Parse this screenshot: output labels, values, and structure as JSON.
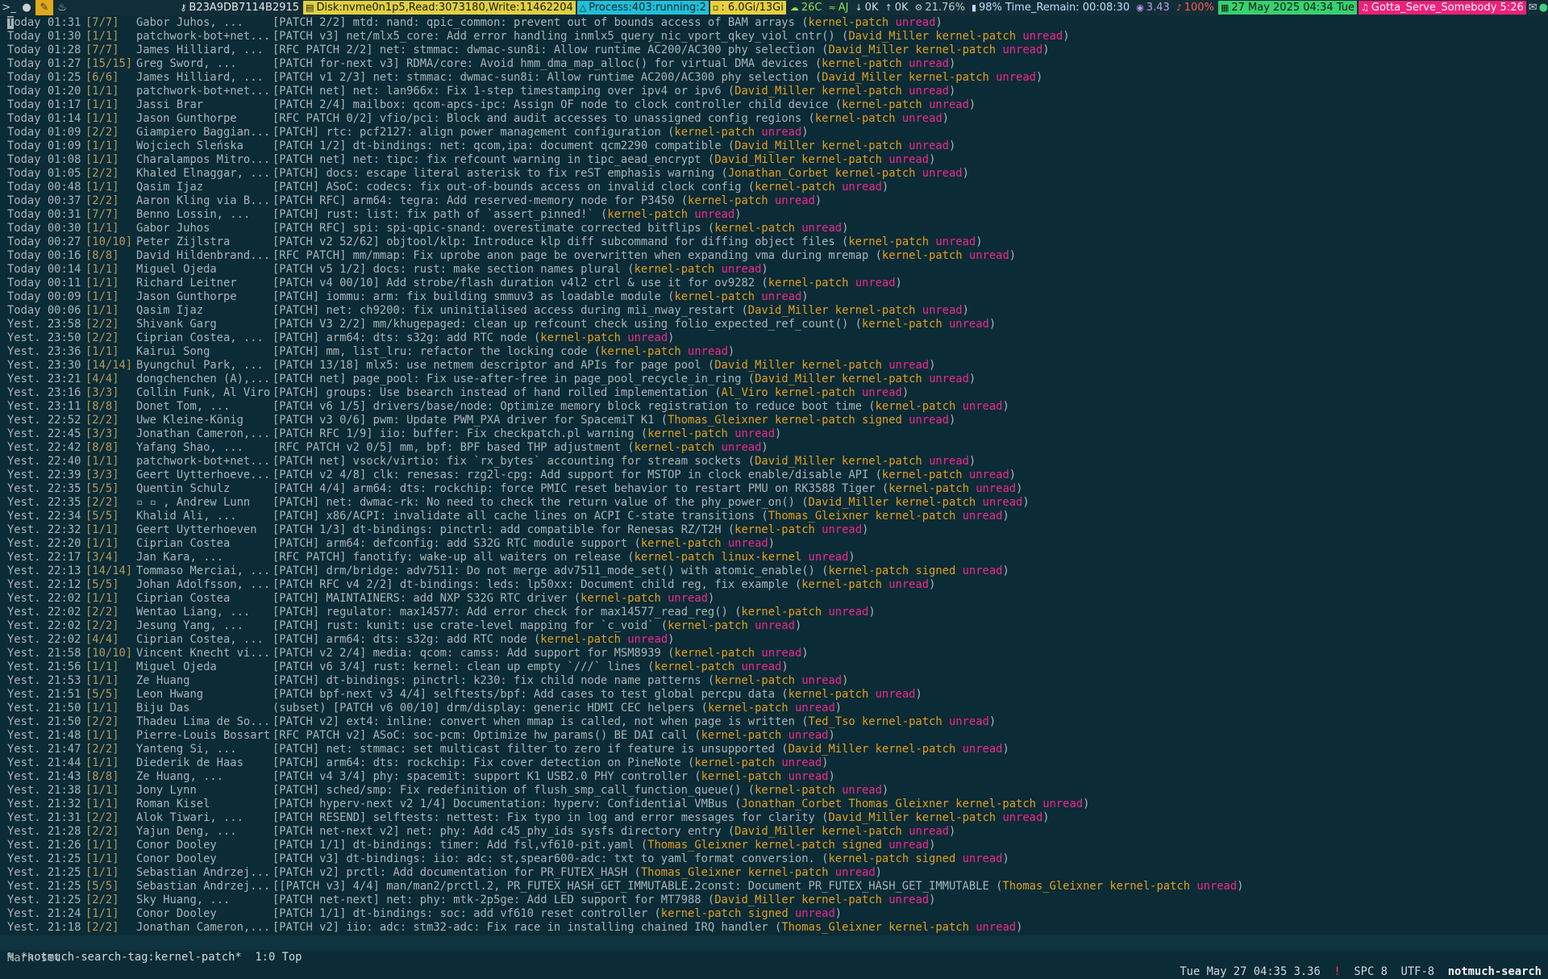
{
  "topbar": {
    "host": "B23A9DB7114B2915",
    "disk": "Disk:nvme0n1p5,Read:3073180,Write:11462204",
    "process": "Process:403:running:2",
    "memory": ": 6.0Gi/13Gi",
    "temp": "26C",
    "wifi": "AJ",
    "net_down": "0K",
    "net_up": "0K",
    "cpu": "21.76%",
    "battery": "98% Time_Remain: 00:08:30",
    "load": "3.43",
    "volume": "100%",
    "date": "27 May 2025 04:34 Tue",
    "music": "Gotta_Serve_Somebody 5:26"
  },
  "messages": [
    {
      "date": "Today 01:31",
      "count": "[7/7]",
      "author": "Gabor Juhos, ...",
      "subject": "[PATCH 2/2] mtd: nand: qpic_common: prevent out of bounds access of BAM arrays",
      "tags": "kernel-patch",
      "unread": "unread"
    },
    {
      "date": "Today 01:30",
      "count": "[1/1]",
      "author": "patchwork-bot+net...",
      "subject": "[PATCH v3] net/mlx5_core: Add error handling inmlx5_query_nic_vport_qkey_viol_cntr()",
      "tags": "David_Miller kernel-patch",
      "unread": "unread"
    },
    {
      "date": "Today 01:28",
      "count": "[7/7]",
      "author": "James Hilliard, ...",
      "subject": "[RFC PATCH 2/2] net: stmmac: dwmac-sun8i: Allow runtime AC200/AC300 phy selection",
      "tags": "David_Miller kernel-patch",
      "unread": "unread"
    },
    {
      "date": "Today 01:27",
      "count": "[15/15]",
      "author": "Greg Sword, ...",
      "subject": "[PATCH for-next v3] RDMA/core: Avoid hmm_dma_map_alloc() for virtual DMA devices",
      "tags": "kernel-patch",
      "unread": "unread"
    },
    {
      "date": "Today 01:25",
      "count": "[6/6]",
      "author": "James Hilliard, ...",
      "subject": "[PATCH v1 2/3] net: stmmac: dwmac-sun8i: Allow runtime AC200/AC300 phy selection",
      "tags": "David_Miller kernel-patch",
      "unread": "unread"
    },
    {
      "date": "Today 01:20",
      "count": "[1/1]",
      "author": "patchwork-bot+net...",
      "subject": "[PATCH net] net: lan966x: Fix 1-step timestamping over ipv4 or ipv6",
      "tags": "David_Miller kernel-patch",
      "unread": "unread"
    },
    {
      "date": "Today 01:17",
      "count": "[1/1]",
      "author": "Jassi Brar",
      "subject": "[PATCH 2/4] mailbox: qcom-apcs-ipc: Assign OF node to clock controller child device",
      "tags": "kernel-patch",
      "unread": "unread"
    },
    {
      "date": "Today 01:14",
      "count": "[1/1]",
      "author": "Jason Gunthorpe",
      "subject": "[RFC PATCH 0/2] vfio/pci: Block and audit accesses to unassigned config regions",
      "tags": "kernel-patch",
      "unread": "unread"
    },
    {
      "date": "Today 01:09",
      "count": "[2/2]",
      "author": "Giampiero Baggian...",
      "subject": "[PATCH] rtc: pcf2127: align power management configuration",
      "tags": "kernel-patch",
      "unread": "unread"
    },
    {
      "date": "Today 01:09",
      "count": "[1/1]",
      "author": "Wojciech Sleńska",
      "subject": "[PATCH 1/2] dt-bindings: net: qcom,ipa: document qcm2290 compatible",
      "tags": "David_Miller kernel-patch",
      "unread": "unread"
    },
    {
      "date": "Today 01:08",
      "count": "[1/1]",
      "author": "Charalampos Mitro...",
      "subject": "[PATCH net] net: tipc: fix refcount warning in tipc_aead_encrypt",
      "tags": "David_Miller kernel-patch",
      "unread": "unread"
    },
    {
      "date": "Today 01:05",
      "count": "[2/2]",
      "author": "Khaled Elnaggar, ...",
      "subject": "[PATCH] docs: escape literal asterisk to fix reST emphasis warning",
      "tags": "Jonathan_Corbet kernel-patch",
      "unread": "unread"
    },
    {
      "date": "Today 00:48",
      "count": "[1/1]",
      "author": "Qasim Ijaz",
      "subject": "[PATCH] ASoC: codecs: fix out-of-bounds access on invalid clock config",
      "tags": "kernel-patch",
      "unread": "unread"
    },
    {
      "date": "Today 00:37",
      "count": "[2/2]",
      "author": "Aaron Kling via B...",
      "subject": "[PATCH RFC] arm64: tegra: Add reserved-memory node for P3450",
      "tags": "kernel-patch",
      "unread": "unread"
    },
    {
      "date": "Today 00:31",
      "count": "[7/7]",
      "author": "Benno Lossin, ...",
      "subject": "[PATCH] rust: list: fix path of `assert_pinned!`",
      "tags": "kernel-patch",
      "unread": "unread"
    },
    {
      "date": "Today 00:30",
      "count": "[1/1]",
      "author": "Gabor Juhos",
      "subject": "[PATCH RFC] spi: spi-qpic-snand: overestimate corrected bitflips",
      "tags": "kernel-patch",
      "unread": "unread"
    },
    {
      "date": "Today 00:27",
      "count": "[10/10]",
      "author": "Peter Zijlstra",
      "subject": "[PATCH v2 52/62] objtool/klp: Introduce klp diff subcommand for diffing object files",
      "tags": "kernel-patch",
      "unread": "unread"
    },
    {
      "date": "Today 00:16",
      "count": "[8/8]",
      "author": "David Hildenbrand...",
      "subject": "[RFC PATCH] mm/mmap: Fix uprobe anon page be overwritten when expanding vma during mremap",
      "tags": "kernel-patch",
      "unread": "unread"
    },
    {
      "date": "Today 00:14",
      "count": "[1/1]",
      "author": "Miguel Ojeda",
      "subject": "[PATCH v5 1/2] docs: rust: make section names plural",
      "tags": "kernel-patch",
      "unread": "unread"
    },
    {
      "date": "Today 00:11",
      "count": "[1/1]",
      "author": "Richard Leitner",
      "subject": "[PATCH v4 00/10] Add strobe/flash duration v4l2 ctrl & use it for ov9282",
      "tags": "kernel-patch",
      "unread": "unread"
    },
    {
      "date": "Today 00:09",
      "count": "[1/1]",
      "author": "Jason Gunthorpe",
      "subject": "[PATCH] iommu: arm: fix building smmuv3 as loadable module",
      "tags": "kernel-patch",
      "unread": "unread"
    },
    {
      "date": "Today 00:06",
      "count": "[1/1]",
      "author": "Qasim Ijaz",
      "subject": "[PATCH] net: ch9200: fix uninitialised access during mii_nway_restart",
      "tags": "David_Miller kernel-patch",
      "unread": "unread"
    },
    {
      "date": "Yest. 23:58",
      "count": "[2/2]",
      "author": "Shivank Garg",
      "subject": "[PATCH V3 2/2] mm/khugepaged: clean up refcount check using folio_expected_ref_count()",
      "tags": "kernel-patch",
      "unread": "unread"
    },
    {
      "date": "Yest. 23:50",
      "count": "[2/2]",
      "author": "Ciprian Costea, ...",
      "subject": "[PATCH] arm64: dts: s32g: add RTC node",
      "tags": "kernel-patch",
      "unread": "unread"
    },
    {
      "date": "Yest. 23:36",
      "count": "[1/1]",
      "author": "Kairui Song",
      "subject": "[PATCH] mm, list_lru: refactor the locking code",
      "tags": "kernel-patch",
      "unread": "unread"
    },
    {
      "date": "Yest. 23:30",
      "count": "[14/14]",
      "author": "Byungchul Park, ...",
      "subject": "[PATCH 13/18] mlx5: use netmem descriptor and APIs for page pool",
      "tags": "David_Miller kernel-patch",
      "unread": "unread"
    },
    {
      "date": "Yest. 23:21",
      "count": "[4/4]",
      "author": "dongchenchen (A),...",
      "subject": "[PATCH net] page_pool: Fix use-after-free in page_pool_recycle_in_ring",
      "tags": "David_Miller kernel-patch",
      "unread": "unread"
    },
    {
      "date": "Yest. 23:16",
      "count": "[3/3]",
      "author": "Collin Funk, Al Viro",
      "subject": "[PATCH] groups: Use bsearch instead of hand rolled implementation",
      "tags": "Al_Viro kernel-patch",
      "unread": "unread"
    },
    {
      "date": "Yest. 23:11",
      "count": "[8/8]",
      "author": "Donet Tom, ...",
      "subject": "[PATCH v6 1/5] drivers/base/node: Optimize memory block registration to reduce boot time",
      "tags": "kernel-patch",
      "unread": "unread"
    },
    {
      "date": "Yest. 22:52",
      "count": "[2/2]",
      "author": "Uwe Kleine-König",
      "subject": "[PATCH v3 0/6] pwm: Update PWM_PXA driver for SpacemiT K1",
      "tags": "Thomas_Gleixner kernel-patch signed",
      "unread": "unread"
    },
    {
      "date": "Yest. 22:45",
      "count": "[3/3]",
      "author": "Jonathan Cameron,...",
      "subject": "[PATCH RFC 1/9] iio: buffer: Fix checkpatch.pl warning",
      "tags": "kernel-patch",
      "unread": "unread"
    },
    {
      "date": "Yest. 22:42",
      "count": "[8/8]",
      "author": "Yafang Shao, ...",
      "subject": "[RFC PATCH v2 0/5] mm, bpf: BPF based THP adjustment",
      "tags": "kernel-patch",
      "unread": "unread"
    },
    {
      "date": "Yest. 22:40",
      "count": "[1/1]",
      "author": "patchwork-bot+net...",
      "subject": "[PATCH net] vsock/virtio: fix `rx_bytes` accounting for stream sockets",
      "tags": "David_Miller kernel-patch",
      "unread": "unread"
    },
    {
      "date": "Yest. 22:39",
      "count": "[3/3]",
      "author": "Geert Uytterhoeve...",
      "subject": "[PATCH v2 4/8] clk: renesas: rzg2l-cpg: Add support for MSTOP in clock enable/disable API",
      "tags": "kernel-patch",
      "unread": "unread"
    },
    {
      "date": "Yest. 22:35",
      "count": "[5/5]",
      "author": "Quentin Schulz",
      "subject": "[PATCH 4/4] arm64: dts: rockchip: force PMIC reset behavior to restart PMU on RK3588 Tiger",
      "tags": "kernel-patch",
      "unread": "unread"
    },
    {
      "date": "Yest. 22:35",
      "count": "[2/2]",
      "author": "▫ ▫ , Andrew Lunn",
      "subject": "[PATCH] net: dwmac-rk: No need to check the return value of the phy_power_on()",
      "tags": "David_Miller kernel-patch",
      "unread": "unread"
    },
    {
      "date": "Yest. 22:34",
      "count": "[5/5]",
      "author": "Khalid Ali, ...",
      "subject": "[PATCH] x86/ACPI: invalidate all cache lines on ACPI C-state transitions",
      "tags": "Thomas_Gleixner kernel-patch",
      "unread": "unread"
    },
    {
      "date": "Yest. 22:32",
      "count": "[1/1]",
      "author": "Geert Uytterhoeven",
      "subject": "[PATCH 1/3] dt-bindings: pinctrl: add compatible for Renesas RZ/T2H",
      "tags": "kernel-patch",
      "unread": "unread"
    },
    {
      "date": "Yest. 22:20",
      "count": "[1/1]",
      "author": "Ciprian Costea",
      "subject": "[PATCH] arm64: defconfig: add S32G RTC module support",
      "tags": "kernel-patch",
      "unread": "unread"
    },
    {
      "date": "Yest. 22:17",
      "count": "[3/4]",
      "author": "Jan Kara, ...",
      "subject": "[RFC PATCH] fanotify: wake-up all waiters on release",
      "tags": "kernel-patch linux-kernel",
      "unread": "unread"
    },
    {
      "date": "Yest. 22:13",
      "count": "[14/14]",
      "author": "Tommaso Merciai, ...",
      "subject": "[PATCH] drm/bridge: adv7511: Do not merge adv7511_mode_set() with atomic_enable()",
      "tags": "kernel-patch signed",
      "unread": "unread"
    },
    {
      "date": "Yest. 22:12",
      "count": "[5/5]",
      "author": "Johan Adolfsson, ...",
      "subject": "[PATCH RFC v4 2/2] dt-bindings: leds: lp50xx: Document child reg, fix example",
      "tags": "kernel-patch",
      "unread": "unread"
    },
    {
      "date": "Yest. 22:02",
      "count": "[1/1]",
      "author": "Ciprian Costea",
      "subject": "[PATCH] MAINTAINERS: add NXP S32G RTC driver",
      "tags": "kernel-patch",
      "unread": "unread"
    },
    {
      "date": "Yest. 22:02",
      "count": "[2/2]",
      "author": "Wentao Liang, ...",
      "subject": "[PATCH] regulator: max14577: Add error check for max14577_read_reg()",
      "tags": "kernel-patch",
      "unread": "unread"
    },
    {
      "date": "Yest. 22:02",
      "count": "[2/2]",
      "author": "Jesung Yang, ...",
      "subject": "[PATCH] rust: kunit: use crate-level mapping for `c_void`",
      "tags": "kernel-patch",
      "unread": "unread"
    },
    {
      "date": "Yest. 22:02",
      "count": "[4/4]",
      "author": "Ciprian Costea, ...",
      "subject": "[PATCH] arm64: dts: s32g: add RTC node",
      "tags": "kernel-patch",
      "unread": "unread"
    },
    {
      "date": "Yest. 21:58",
      "count": "[10/10]",
      "author": "Vincent Knecht vi...",
      "subject": "[PATCH v2 2/4] media: qcom: camss: Add support for MSM8939",
      "tags": "kernel-patch",
      "unread": "unread"
    },
    {
      "date": "Yest. 21:56",
      "count": "[1/1]",
      "author": "Miguel Ojeda",
      "subject": "[PATCH v6 3/4] rust: kernel: clean up empty `///` lines",
      "tags": "kernel-patch",
      "unread": "unread"
    },
    {
      "date": "Yest. 21:53",
      "count": "[1/1]",
      "author": "Ze Huang",
      "subject": "[PATCH] dt-bindings: pinctrl: k230: fix child node name patterns",
      "tags": "kernel-patch",
      "unread": "unread"
    },
    {
      "date": "Yest. 21:51",
      "count": "[5/5]",
      "author": "Leon Hwang",
      "subject": "[PATCH bpf-next v3 4/4] selftests/bpf: Add cases to test global percpu data",
      "tags": "kernel-patch",
      "unread": "unread"
    },
    {
      "date": "Yest. 21:50",
      "count": "[1/1]",
      "author": "Biju Das",
      "subject": "(subset) [PATCH v6 00/10] drm/display: generic HDMI CEC helpers",
      "tags": "kernel-patch",
      "unread": "unread"
    },
    {
      "date": "Yest. 21:50",
      "count": "[2/2]",
      "author": "Thadeu Lima de So...",
      "subject": "[PATCH v2] ext4: inline: convert when mmap is called, not when page is written",
      "tags": "Ted_Tso kernel-patch",
      "unread": "unread"
    },
    {
      "date": "Yest. 21:48",
      "count": "[1/1]",
      "author": "Pierre-Louis Bossart",
      "subject": "[RFC PATCH v2] ASoC: soc-pcm: Optimize hw_params() BE DAI call",
      "tags": "kernel-patch",
      "unread": "unread"
    },
    {
      "date": "Yest. 21:47",
      "count": "[2/2]",
      "author": "Yanteng Si, ...",
      "subject": "[PATCH] net: stmmac: set multicast filter to zero if feature is unsupported",
      "tags": "David_Miller kernel-patch",
      "unread": "unread"
    },
    {
      "date": "Yest. 21:44",
      "count": "[1/1]",
      "author": "Diederik de Haas",
      "subject": "[PATCH] arm64: dts: rockchip: Fix cover detection on PineNote",
      "tags": "kernel-patch",
      "unread": "unread"
    },
    {
      "date": "Yest. 21:43",
      "count": "[8/8]",
      "author": "Ze Huang, ...",
      "subject": "[PATCH v4 3/4] phy: spacemit: support K1 USB2.0 PHY controller",
      "tags": "kernel-patch",
      "unread": "unread"
    },
    {
      "date": "Yest. 21:38",
      "count": "[1/1]",
      "author": "Jony Lynn",
      "subject": "[PATCH] sched/smp: Fix redefinition of flush_smp_call_function_queue()",
      "tags": "kernel-patch",
      "unread": "unread"
    },
    {
      "date": "Yest. 21:32",
      "count": "[1/1]",
      "author": "Roman Kisel",
      "subject": "[PATCH hyperv-next v2 1/4] Documentation: hyperv: Confidential VMBus",
      "tags": "Jonathan_Corbet Thomas_Gleixner kernel-patch",
      "unread": "unread"
    },
    {
      "date": "Yest. 21:31",
      "count": "[2/2]",
      "author": "Alok Tiwari, ...",
      "subject": "[PATCH RESEND] selftests: nettest: Fix typo in log and error messages for clarity",
      "tags": "David_Miller kernel-patch",
      "unread": "unread"
    },
    {
      "date": "Yest. 21:28",
      "count": "[2/2]",
      "author": "Yajun Deng, ...",
      "subject": "[PATCH net-next v2] net: phy: Add c45_phy_ids sysfs directory entry",
      "tags": "David_Miller kernel-patch",
      "unread": "unread"
    },
    {
      "date": "Yest. 21:26",
      "count": "[1/1]",
      "author": "Conor Dooley",
      "subject": "[PATCH 1/1] dt-bindings: timer: Add fsl,vf610-pit.yaml",
      "tags": "Thomas_Gleixner kernel-patch signed",
      "unread": "unread"
    },
    {
      "date": "Yest. 21:25",
      "count": "[1/1]",
      "author": "Conor Dooley",
      "subject": "[PATCH v3] dt-bindings: iio: adc: st,spear600-adc: txt to yaml format conversion.",
      "tags": "kernel-patch signed",
      "unread": "unread"
    },
    {
      "date": "Yest. 21:25",
      "count": "[1/1]",
      "author": "Sebastian Andrzej...",
      "subject": "[PATCH v2] prctl: Add documentation for PR_FUTEX_HASH",
      "tags": "Thomas_Gleixner kernel-patch",
      "unread": "unread"
    },
    {
      "date": "Yest. 21:25",
      "count": "[5/5]",
      "author": "Sebastian Andrzej...",
      "subject": "[[PATCH v3] 4/4] man/man2/prctl.2, PR_FUTEX_HASH_GET_IMMUTABLE.2const: Document PR_FUTEX_HASH_GET_IMMUTABLE",
      "tags": "Thomas_Gleixner kernel-patch",
      "unread": "unread"
    },
    {
      "date": "Yest. 21:25",
      "count": "[2/2]",
      "author": "Sky Huang, ...",
      "subject": "[PATCH net-next] net: phy: mtk-2p5ge: Add LED support for MT7988",
      "tags": "David_Miller kernel-patch",
      "unread": "unread"
    },
    {
      "date": "Yest. 21:24",
      "count": "[1/1]",
      "author": "Conor Dooley",
      "subject": "[PATCH 1/1] dt-bindings: soc: add vf610 reset controller",
      "tags": "kernel-patch signed",
      "unread": "unread"
    },
    {
      "date": "Yest. 21:18",
      "count": "[2/2]",
      "author": "Jonathan Cameron,...",
      "subject": "[PATCH v2] iio: adc: stm32-adc: Fix race in installing chained IRQ handler",
      "tags": "Thomas_Gleixner kernel-patch",
      "unread": "unread"
    }
  ],
  "modeline": {
    "left": "% *notmuch-search-tag:kernel-patch*  1:0 Top",
    "datetime": "Tue May 27 04:35 3.36",
    "bang": "!",
    "spc": "SPC 8",
    "encoding": "UTF-8",
    "major_mode": "notmuch-search"
  },
  "echo": "Mark set"
}
